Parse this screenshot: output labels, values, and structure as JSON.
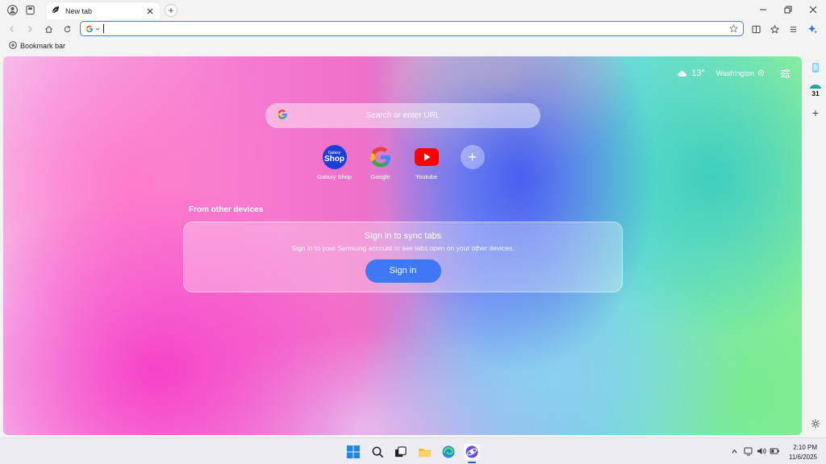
{
  "tab": {
    "title": "New tab"
  },
  "newtab_symbol": "+",
  "urlbar": {
    "value": "",
    "engine": "G"
  },
  "bookmarkbar": {
    "label": "Bookmark bar"
  },
  "weather": {
    "temp": "13°",
    "city": "Washington"
  },
  "search": {
    "placeholder": "Search or enter URL"
  },
  "shortcuts": [
    {
      "label": "Galaxy Shop",
      "icon": "galaxy-shop-icon",
      "line1": "Galaxy",
      "line2": "Shop"
    },
    {
      "label": "Google",
      "icon": "google-icon"
    },
    {
      "label": "Youtube",
      "icon": "youtube-icon"
    },
    {
      "label": "",
      "icon": "plus-icon",
      "symbol": "+"
    }
  ],
  "sync": {
    "section_title": "From other devices",
    "title": "Sign in to sync tabs",
    "desc": "Sign in to your Samsung account to see tabs open on your other devices.",
    "button": "Sign in"
  },
  "sidebar": {
    "calendar_day": "31",
    "add_symbol": "+"
  },
  "clock": {
    "time": "2:10 PM",
    "date": "11/6/2025"
  },
  "colors": {
    "accent": "#3f78f5",
    "url_border": "#3b7ff0",
    "galaxy_blue": "#1a3fd6",
    "youtube_red": "#ff0000"
  }
}
